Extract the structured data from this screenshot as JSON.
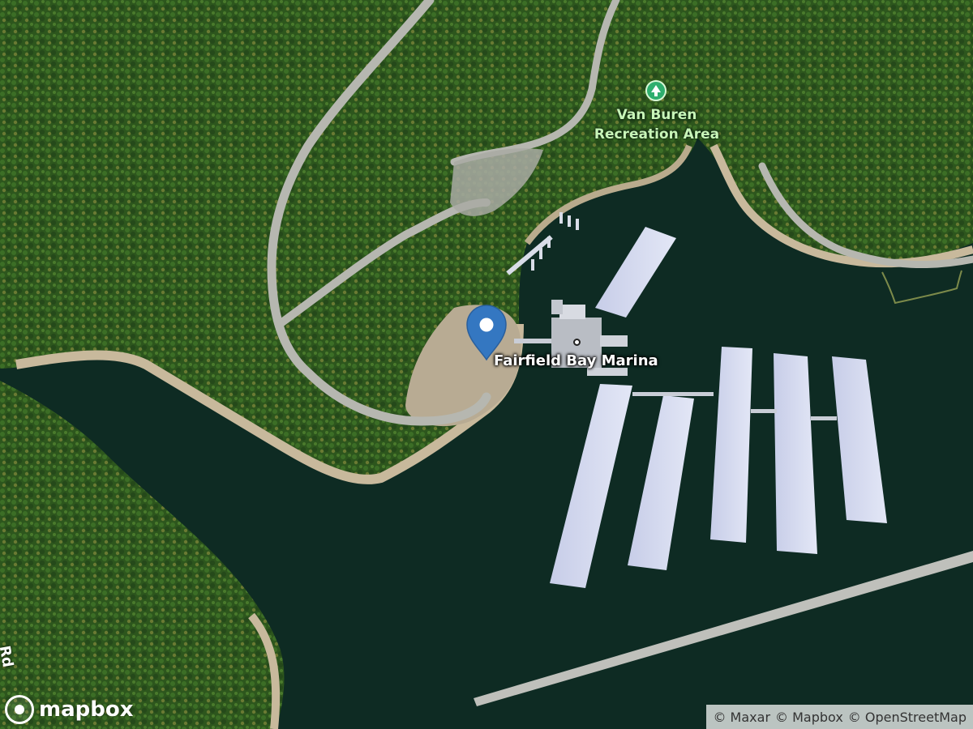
{
  "map": {
    "style": "satellite",
    "colors": {
      "water": "#0e2b23",
      "forest": "#2f5a1e",
      "shore": "#c8b99c",
      "pin": "#3477c1"
    }
  },
  "places": {
    "recreation_area": {
      "line1": "Van Buren",
      "line2": "Recreation Area",
      "icon": "tree-icon"
    },
    "marina": {
      "name": "Fairfield Bay Marina",
      "icon": "marina-point-icon"
    }
  },
  "pin": {
    "icon": "location-pin-icon"
  },
  "edge_road_fragment": "Rd",
  "branding": {
    "logo_text": "mapbox",
    "icon": "mapbox-logo-icon"
  },
  "attribution": {
    "maxar": "© Maxar",
    "mapbox": "© Mapbox",
    "osm": "© OpenStreetMap"
  }
}
